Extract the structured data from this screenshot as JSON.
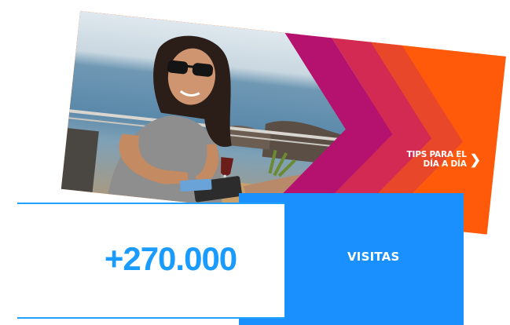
{
  "banner": {
    "cta_line1": "TIPS PARA EL",
    "cta_line2": "DÍA A DÍA",
    "cta_icon": "chevron-right-icon",
    "colors": {
      "background": "#ff5a0a",
      "stripe_1": "#b4126e",
      "stripe_2": "#d22a52",
      "stripe_3": "#e9472a"
    }
  },
  "stat": {
    "value": "+270.000",
    "label": "VISITAS",
    "colors": {
      "value": "#1a9bff",
      "label_box": "#1a90ff",
      "rule": "#1ea1ff"
    }
  }
}
